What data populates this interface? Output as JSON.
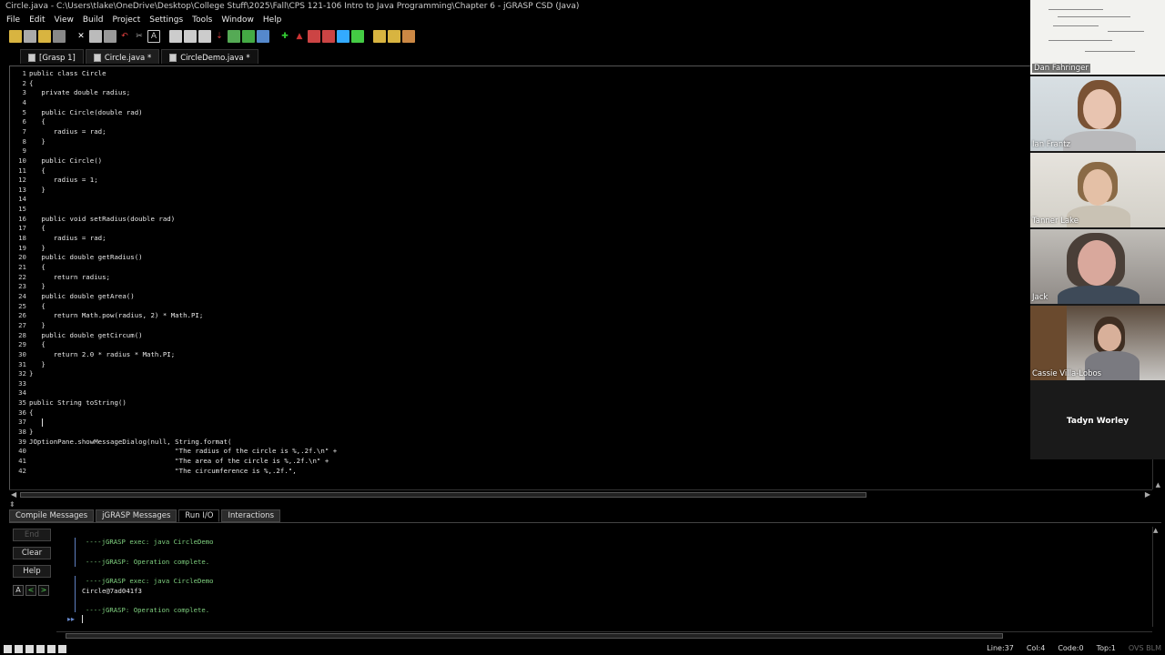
{
  "window": {
    "title": "Circle.java - C:\\Users\\tlake\\OneDrive\\Desktop\\College Stuff\\2025\\Fall\\CPS 121-106 Intro to Java Programming\\Chapter 6 - jGRASP CSD (Java)"
  },
  "menu": [
    "File",
    "Edit",
    "View",
    "Build",
    "Project",
    "Settings",
    "Tools",
    "Window",
    "Help"
  ],
  "tabs": [
    {
      "label": "[Grasp 1]"
    },
    {
      "label": "Circle.java *"
    },
    {
      "label": "CircleDemo.java *"
    }
  ],
  "code": [
    {
      "n": "1",
      "text": "public class Circle"
    },
    {
      "n": "2",
      "text": "{"
    },
    {
      "n": "3",
      "text": "   private double radius;"
    },
    {
      "n": "4",
      "text": ""
    },
    {
      "n": "5",
      "text": "   public Circle(double rad)"
    },
    {
      "n": "6",
      "text": "   {"
    },
    {
      "n": "7",
      "text": "      radius = rad;"
    },
    {
      "n": "8",
      "text": "   }"
    },
    {
      "n": "9",
      "text": ""
    },
    {
      "n": "10",
      "text": "   public Circle()"
    },
    {
      "n": "11",
      "text": "   {"
    },
    {
      "n": "12",
      "text": "      radius = 1;"
    },
    {
      "n": "13",
      "text": "   }"
    },
    {
      "n": "14",
      "text": ""
    },
    {
      "n": "15",
      "text": ""
    },
    {
      "n": "16",
      "text": "   public void setRadius(double rad)"
    },
    {
      "n": "17",
      "text": "   {"
    },
    {
      "n": "18",
      "text": "      radius = rad;"
    },
    {
      "n": "19",
      "text": "   }"
    },
    {
      "n": "20",
      "text": "   public double getRadius()"
    },
    {
      "n": "21",
      "text": "   {"
    },
    {
      "n": "22",
      "text": "      return radius;"
    },
    {
      "n": "23",
      "text": "   }"
    },
    {
      "n": "24",
      "text": "   public double getArea()"
    },
    {
      "n": "25",
      "text": "   {"
    },
    {
      "n": "26",
      "text": "      return Math.pow(radius, 2) * Math.PI;"
    },
    {
      "n": "27",
      "text": "   }"
    },
    {
      "n": "28",
      "text": "   public double getCircum()"
    },
    {
      "n": "29",
      "text": "   {"
    },
    {
      "n": "30",
      "text": "      return 2.0 * radius * Math.PI;"
    },
    {
      "n": "31",
      "text": "   }"
    },
    {
      "n": "32",
      "text": "}"
    },
    {
      "n": "33",
      "text": ""
    },
    {
      "n": "34",
      "text": ""
    },
    {
      "n": "35",
      "text": "public String toString()"
    },
    {
      "n": "36",
      "text": "{"
    },
    {
      "n": "37",
      "text": "   "
    },
    {
      "n": "38",
      "text": "}"
    },
    {
      "n": "39",
      "text": "JOptionPane.showMessageDialog(null, String.format("
    },
    {
      "n": "40",
      "text": "                                    \"The radius of the circle is %,.2f.\\n\" +"
    },
    {
      "n": "41",
      "text": "                                    \"The area of the circle is %,.2f.\\n\" +"
    },
    {
      "n": "42",
      "text": "                                    \"The circumference is %,.2f.\","
    }
  ],
  "bottom_tabs": [
    "Compile Messages",
    "jGRASP Messages",
    "Run I/O",
    "Interactions"
  ],
  "side_buttons": {
    "end": "End",
    "clear": "Clear",
    "help": "Help"
  },
  "console": {
    "exec1": "----jGRASP exec: java CircleDemo",
    "done1": "----jGRASP: Operation complete.",
    "exec2": "----jGRASP exec: java CircleDemo",
    "output": "Circle@7ad041f3",
    "done2": "----jGRASP: Operation complete.",
    "prompt": "▸▸"
  },
  "status": {
    "line": "Line:37",
    "col": "Col:4",
    "code": "Code:0",
    "top": "Top:1",
    "mode": "OVS BLM"
  },
  "participants": [
    {
      "name": "Dan Fahringer"
    },
    {
      "name": "Ian Frantz"
    },
    {
      "name": "Tanner Lake"
    },
    {
      "name": "Jack"
    },
    {
      "name": "Cassie Villa-Lobos"
    },
    {
      "name": "Tadyn Worley"
    }
  ]
}
